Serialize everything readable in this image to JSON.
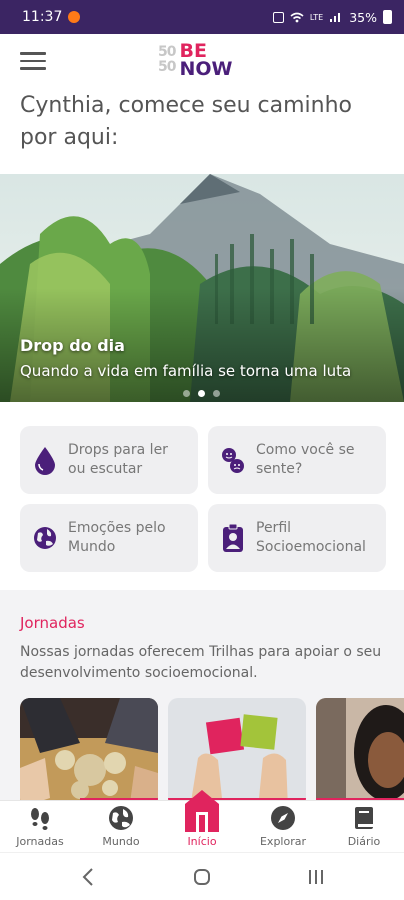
{
  "status_bar": {
    "time": "11:37",
    "signal_text": "LTE",
    "battery": "35%"
  },
  "header": {
    "menu_icon": "hamburger-icon",
    "logo": {
      "top_number": "50",
      "bottom_number": "50",
      "word_top": "BE",
      "word_bottom": "NOW"
    }
  },
  "greeting": "Cynthia, comece seu caminho por aqui:",
  "hero": {
    "title": "Drop do dia",
    "subtitle": "Quando a vida em família se torna uma luta",
    "dots": 3,
    "active_dot": 1
  },
  "tiles": [
    {
      "label": "Drops para ler ou escutar",
      "icon": "drop-icon"
    },
    {
      "label": "Como você se sente?",
      "icon": "emotions-icon"
    },
    {
      "label": "Emoções pelo Mundo",
      "icon": "globe-icon"
    },
    {
      "label": "Perfil Socioemocional",
      "icon": "profile-badge-icon"
    }
  ],
  "journeys": {
    "title": "Jornadas",
    "description": "Nossas jornadas oferecem Trilhas para apoiar o seu desenvolvimento socioemocional."
  },
  "bottom_nav": [
    {
      "label": "Jornadas",
      "icon": "footprints-icon"
    },
    {
      "label": "Mundo",
      "icon": "globe-icon"
    },
    {
      "label": "Início",
      "icon": "home-icon",
      "active": true
    },
    {
      "label": "Explorar",
      "icon": "compass-icon"
    },
    {
      "label": "Diário",
      "icon": "book-icon"
    }
  ],
  "colors": {
    "brand_purple": "#4b1f7a",
    "brand_pink": "#e0245e",
    "status_bar": "#3b2563"
  }
}
